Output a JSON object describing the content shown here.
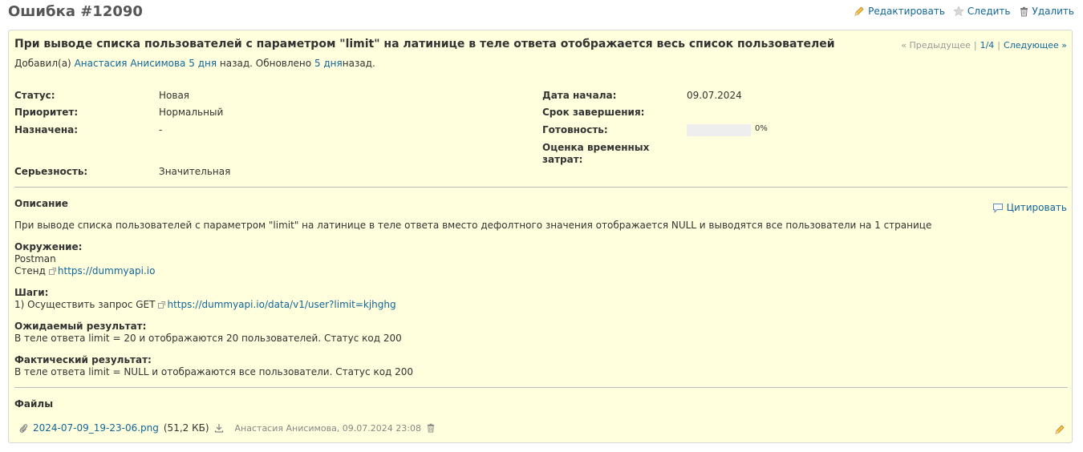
{
  "page_title": "Ошибка #12090",
  "contextual": {
    "edit_label": "Редактировать",
    "watch_label": "Следить",
    "delete_label": "Удалить"
  },
  "issue": {
    "subject": "При выводе списка пользователей с параметром \"limit\" на латинице в теле ответа отображается весь список пользователей",
    "prevnext": {
      "prev_label": "« Предыдущее",
      "counter": "1/4",
      "next_label": "Следующее »"
    },
    "author": {
      "prefix": "Добавил(а)",
      "name": "Анастасия Анисимова",
      "added_ago": "5 дня",
      "middle": "назад. Обновлено",
      "updated_ago": "5 дня",
      "suffix": "назад."
    },
    "attributes": {
      "status_label": "Статус:",
      "status_value": "Новая",
      "priority_label": "Приоритет:",
      "priority_value": "Нормальный",
      "assigned_label": "Назначена:",
      "assigned_value": "-",
      "severity_label": "Серьезность:",
      "severity_value": "Значительная",
      "start_label": "Дата начала:",
      "start_value": "09.07.2024",
      "due_label": "Срок завершения:",
      "due_value": "",
      "done_label": "Готовность:",
      "done_value": "0%",
      "done_ratio": 0,
      "estimate_label_1": "Оценка временных",
      "estimate_label_2": "затрат:"
    },
    "description": {
      "title": "Описание",
      "quote_label": "Цитировать",
      "text": "При выводе списка пользователей с параметром \"limit\" на латинице в теле ответа вместо дефолтного значения отображается NULL и выводятся все пользователи на 1 странице",
      "env_title": "Окружение:",
      "env_line1": "Postman",
      "env_stand_label": "Стенд",
      "env_stand_url": "https://dummyapi.io",
      "steps_title": "Шаги:",
      "steps_line_prefix": "1) Осуществить запрос GET",
      "steps_url": "https://dummyapi.io/data/v1/user?limit=kjhghg",
      "expected_title": "Ожидаемый результат:",
      "expected_text": "В теле ответа limit = 20 и отображаются 20 пользователей. Статус код 200",
      "actual_title": "Фактический результат:",
      "actual_text": "В теле ответа limit = NULL и отображаются все пользователи. Статус код 200"
    },
    "files": {
      "title": "Файлы",
      "items": [
        {
          "name": "2024-07-09_19-23-06.png",
          "size": "(51,2 КБ)",
          "meta": "Анастасия Анисимова, 09.07.2024 23:08"
        }
      ]
    }
  },
  "colors": {
    "link": "#116699",
    "issue_bg": "#ffffdd",
    "issue_border": "#d7d7d7"
  }
}
